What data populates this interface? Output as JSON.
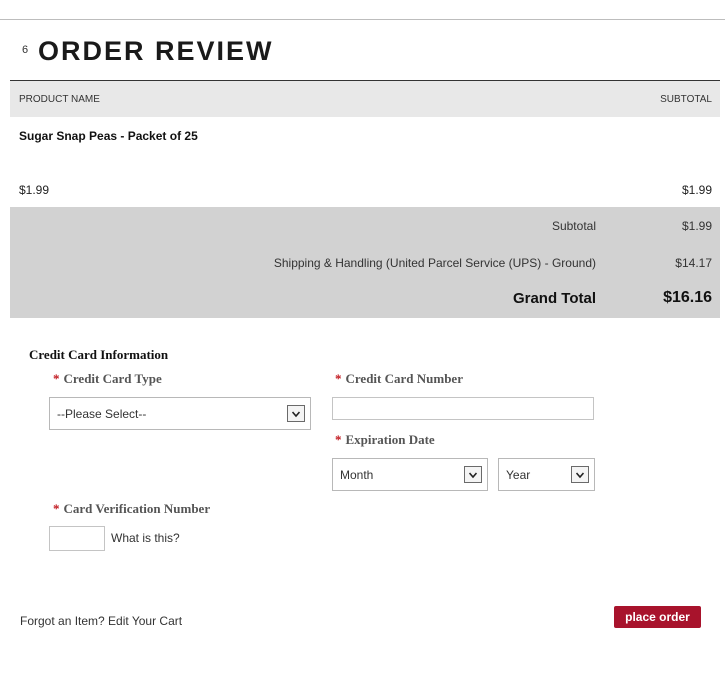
{
  "step": {
    "number": "6",
    "title": "ORDER REVIEW"
  },
  "table": {
    "headers": {
      "product": "PRODUCT NAME",
      "subtotal": "SUBTOTAL"
    },
    "items": [
      {
        "name": "Sugar Snap Peas - Packet of 25",
        "price": "$1.99",
        "subtotal": "$1.99"
      }
    ]
  },
  "totals": {
    "subtotal_label": "Subtotal",
    "subtotal_value": "$1.99",
    "shipping_label": "Shipping & Handling (United Parcel Service (UPS) - Ground)",
    "shipping_value": "$14.17",
    "grand_label": "Grand Total",
    "grand_value": "$16.16"
  },
  "credit_card": {
    "heading": "Credit Card Information",
    "required_mark": "*",
    "card_type": {
      "label": "Credit Card Type",
      "value": "--Please Select--"
    },
    "card_number": {
      "label": "Credit Card Number",
      "value": ""
    },
    "expiration": {
      "label": "Expiration Date",
      "month": "Month",
      "year": "Year"
    },
    "cvn": {
      "label": "Card Verification Number",
      "value": "",
      "help_link": "What is this?"
    }
  },
  "footer": {
    "edit_cart_link": "Forgot an Item? Edit Your Cart",
    "place_order_label": "place order"
  },
  "colors": {
    "accent": "#a8132c",
    "required": "#c0141b",
    "totals_bg": "#d2d2d2",
    "header_bg": "#e8e8e8"
  }
}
